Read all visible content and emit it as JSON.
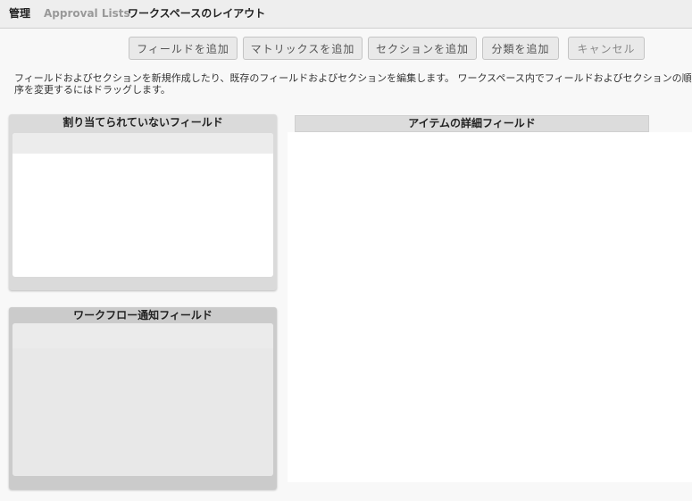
{
  "breadcrumb": {
    "root": "管理",
    "parent": "Approval Lists",
    "current": "ワークスペースのレイアウト"
  },
  "toolbar": {
    "add_field": "フィールドを追加",
    "add_matrix": "マトリックスを追加",
    "add_section": "セクションを追加",
    "add_classification": "分類を追加",
    "cancel": "キャンセル"
  },
  "description": "フィールドおよびセクションを新規作成したり、既存のフィールドおよびセクションを編集します。 ワークスペース内でフィールドおよびセクションの順序を変更するにはドラッグします。",
  "panels": {
    "unassigned": "割り当てられていないフィールド",
    "workflow": "ワークフロー通知フィールド",
    "item_details": "アイテムの詳細フィールド"
  }
}
